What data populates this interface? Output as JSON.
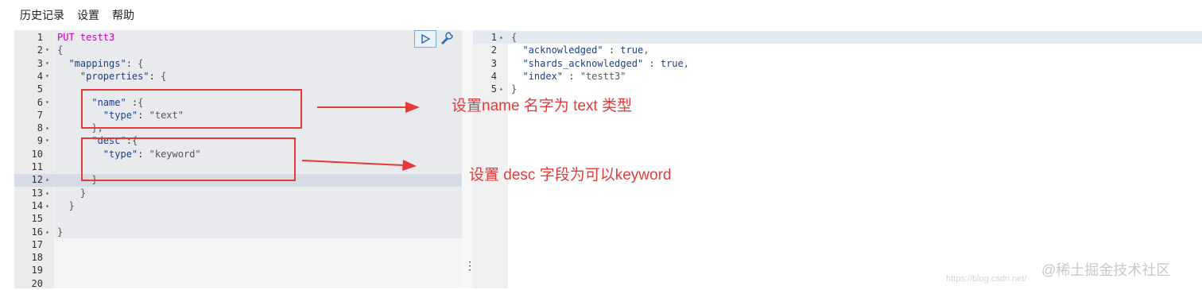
{
  "menu": {
    "history": "历史记录",
    "settings": "设置",
    "help": "帮助"
  },
  "left_editor": {
    "lines": [
      {
        "n": "1",
        "fold": "",
        "text": "PUT testt3"
      },
      {
        "n": "2",
        "fold": "▾",
        "text": "{"
      },
      {
        "n": "3",
        "fold": "▾",
        "text": "  \"mappings\": {"
      },
      {
        "n": "4",
        "fold": "▾",
        "text": "    \"properties\": {"
      },
      {
        "n": "5",
        "fold": "",
        "text": ""
      },
      {
        "n": "6",
        "fold": "▾",
        "text": "      \"name\" :{"
      },
      {
        "n": "7",
        "fold": "",
        "text": "        \"type\": \"text\""
      },
      {
        "n": "8",
        "fold": "▴",
        "text": "      },"
      },
      {
        "n": "9",
        "fold": "▾",
        "text": "      \"desc\":{"
      },
      {
        "n": "10",
        "fold": "",
        "text": "        \"type\": \"keyword\""
      },
      {
        "n": "11",
        "fold": "",
        "text": ""
      },
      {
        "n": "12",
        "fold": "▴",
        "text": "      }"
      },
      {
        "n": "13",
        "fold": "▴",
        "text": "    }"
      },
      {
        "n": "14",
        "fold": "▴",
        "text": "  }"
      },
      {
        "n": "15",
        "fold": "",
        "text": ""
      },
      {
        "n": "16",
        "fold": "▴",
        "text": "}"
      },
      {
        "n": "17",
        "fold": "",
        "text": ""
      },
      {
        "n": "18",
        "fold": "",
        "text": ""
      },
      {
        "n": "19",
        "fold": "",
        "text": ""
      },
      {
        "n": "20",
        "fold": "",
        "text": ""
      }
    ]
  },
  "right_editor": {
    "lines": [
      {
        "n": "1",
        "fold": "▴",
        "text": "{"
      },
      {
        "n": "2",
        "fold": "",
        "text": "  \"acknowledged\" : true,"
      },
      {
        "n": "3",
        "fold": "",
        "text": "  \"shards_acknowledged\" : true,"
      },
      {
        "n": "4",
        "fold": "",
        "text": "  \"index\" : \"testt3\""
      },
      {
        "n": "5",
        "fold": "▴",
        "text": "}"
      }
    ]
  },
  "annotations": {
    "name_note": "设置name 名字为 text 类型",
    "desc_note": "设置 desc 字段为可以keyword"
  },
  "icons": {
    "run": "play-icon",
    "settings": "wrench-icon",
    "splitter": "vertical-dots-icon"
  },
  "colors": {
    "annotation": "#e43a3a",
    "keyword": "#c000c0",
    "string": "#22863a",
    "key": "#1b3e8a"
  },
  "watermark": {
    "text": "@稀土掘金技术社区",
    "url": "https://blog.csdn.net/"
  }
}
